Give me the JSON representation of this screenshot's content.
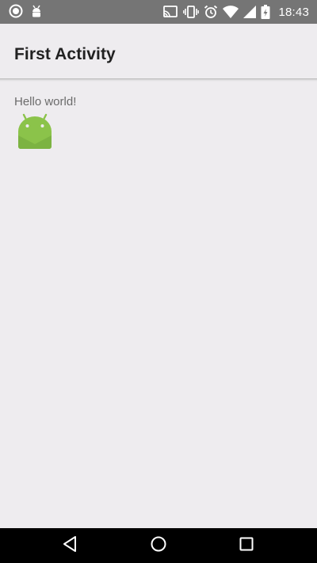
{
  "status_bar": {
    "time": "18:43",
    "left_icons": [
      "record-icon",
      "android-debug-icon"
    ],
    "right_icons": [
      "cast-icon",
      "vibrate-icon",
      "alarm-icon",
      "wifi-icon",
      "signal-icon",
      "battery-charging-icon"
    ]
  },
  "toolbar": {
    "title": "First Activity"
  },
  "content": {
    "text": "Hello world!",
    "image": "android-robot-icon"
  },
  "nav_bar": {
    "buttons": [
      "back-icon",
      "home-icon",
      "recents-icon"
    ]
  },
  "colors": {
    "status_bar": "#757575",
    "background": "#eeecef",
    "title_text": "#212121",
    "body_text": "#6b6b6b",
    "android_green": "#8bc34a",
    "nav_bar": "#000000"
  }
}
